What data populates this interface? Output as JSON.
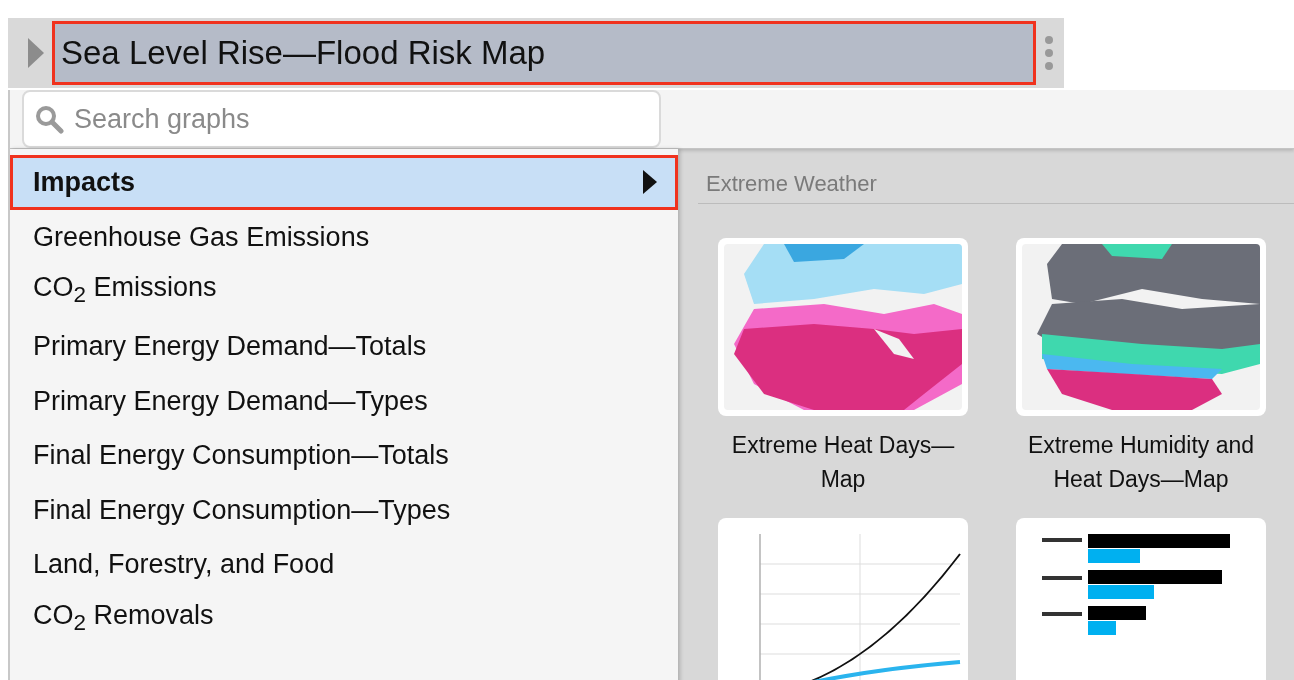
{
  "header": {
    "title": "Sea Level Rise—Flood Risk Map",
    "highlighted": true
  },
  "search": {
    "placeholder": "Search graphs"
  },
  "categories": [
    {
      "label": "Impacts",
      "selected": true,
      "highlighted": true
    },
    {
      "label": "Greenhouse Gas Emissions",
      "selected": false,
      "highlighted": false
    },
    {
      "label": "CO$_{2}$ Emissions",
      "selected": false,
      "highlighted": false
    },
    {
      "label": "Primary Energy Demand—Totals",
      "selected": false,
      "highlighted": false
    },
    {
      "label": "Primary Energy Demand—Types",
      "selected": false,
      "highlighted": false
    },
    {
      "label": "Final Energy Consumption—Totals",
      "selected": false,
      "highlighted": false
    },
    {
      "label": "Final Energy Consumption—Types",
      "selected": false,
      "highlighted": false
    },
    {
      "label": "Land, Forestry, and Food",
      "selected": false,
      "highlighted": false
    },
    {
      "label": "CO$_{2}$ Removals",
      "selected": false,
      "highlighted": false
    }
  ],
  "section": {
    "title": "Extreme Weather"
  },
  "graphs": [
    {
      "caption": "Extreme Heat Days—Map",
      "kind": "heat-map"
    },
    {
      "caption": "Extreme Humidity and Heat Days—Map",
      "kind": "humidity-map"
    },
    {
      "kind": "line-chart"
    },
    {
      "kind": "bar-chart"
    }
  ]
}
